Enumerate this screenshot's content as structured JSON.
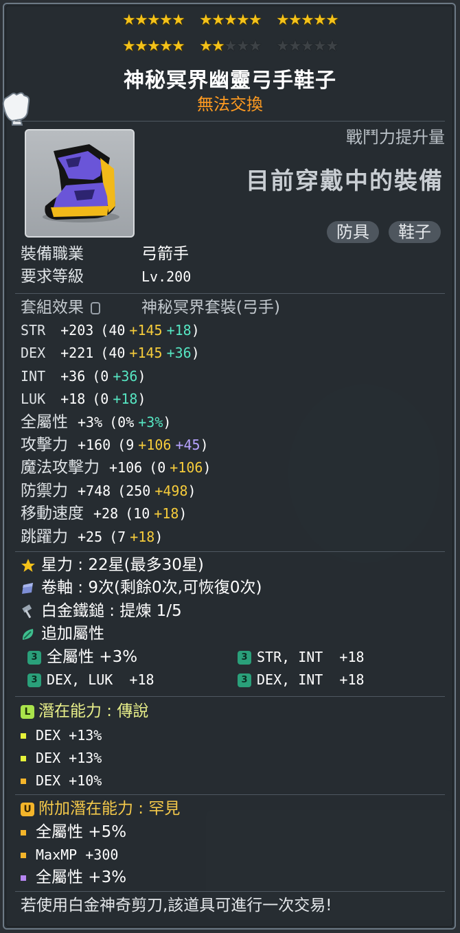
{
  "stars": {
    "filled": 22,
    "total": 30
  },
  "item": {
    "name": "神秘冥界幽靈弓手鞋子",
    "trade_status": "無法交換",
    "combat_power_label": "戰鬥力提升量",
    "equipped_label": "目前穿戴中的裝備",
    "tags": [
      "防具",
      "鞋子"
    ]
  },
  "requirements": {
    "job_label": "裝備職業",
    "job_value": "弓箭手",
    "level_label": "要求等級",
    "level_value": "Lv.200"
  },
  "set": {
    "label": "套組效果",
    "value": "神秘冥界套裝(弓手)"
  },
  "stats": [
    {
      "name": "STR",
      "total": "+203",
      "base": "(40",
      "bonus1": "+145",
      "bonus2": "+18",
      "close": ")",
      "c1": "yellow",
      "c2": "green"
    },
    {
      "name": "DEX",
      "total": "+221",
      "base": "(40",
      "bonus1": "+145",
      "bonus2": "+36",
      "close": ")",
      "c1": "yellow",
      "c2": "green"
    },
    {
      "name": "INT",
      "total": "+36",
      "base": "(0",
      "bonus1": "+36",
      "bonus2": "",
      "close": ")",
      "c1": "green",
      "c2": ""
    },
    {
      "name": "LUK",
      "total": "+18",
      "base": "(0",
      "bonus1": "+18",
      "bonus2": "",
      "close": ")",
      "c1": "green",
      "c2": ""
    },
    {
      "name": "全屬性",
      "total": "+3%",
      "base": "(0%",
      "bonus1": "+3%",
      "bonus2": "",
      "close": ")",
      "c1": "green",
      "c2": ""
    },
    {
      "name": "攻擊力",
      "total": "+160",
      "base": "(9",
      "bonus1": "+106",
      "bonus2": "+45",
      "close": ")",
      "c1": "yellow",
      "c2": "purple"
    },
    {
      "name": "魔法攻擊力",
      "total": "+106",
      "base": "(0",
      "bonus1": "+106",
      "bonus2": "",
      "close": ")",
      "c1": "yellow",
      "c2": ""
    },
    {
      "name": "防禦力",
      "total": "+748",
      "base": "(250",
      "bonus1": "+498",
      "bonus2": "",
      "close": ")",
      "c1": "yellow",
      "c2": ""
    },
    {
      "name": "移動速度",
      "total": "+28",
      "base": "(10",
      "bonus1": "+18",
      "bonus2": "",
      "close": ")",
      "c1": "yellow",
      "c2": ""
    },
    {
      "name": "跳躍力",
      "total": "+25",
      "base": "(7",
      "bonus1": "+18",
      "bonus2": "",
      "close": ")",
      "c1": "yellow",
      "c2": ""
    }
  ],
  "enhance": {
    "starforce": "星力 : 22星(最多30星)",
    "scroll": "卷軸 : 9次(剩餘0次,可恢復0次)",
    "hammer": "白金鐵鎚 : 提煉 1/5",
    "flame_title": "追加屬性",
    "flames": [
      "全屬性 +3%",
      "STR, INT  +18",
      "DEX, LUK  +18",
      "DEX, INT  +18"
    ],
    "flame_tier": "3"
  },
  "potential": {
    "badge": "L",
    "title": "潛在能力 : 傳說",
    "lines": [
      "DEX +13%",
      "DEX +13%",
      "DEX +10%"
    ],
    "bullet_colors": [
      "#e6f23a",
      "#e6f23a",
      "#f4b52a"
    ]
  },
  "additional": {
    "badge": "U",
    "title": "附加潛在能力 : 罕見",
    "lines": [
      "全屬性 +5%",
      "MaxMP +300",
      "全屬性 +3%"
    ],
    "bullet_colors": [
      "#f4b52a",
      "#f4b52a",
      "#b686f2"
    ]
  },
  "footer": "若使用白金神奇剪刀,該道具可進行一次交易!",
  "colors": {
    "yellow": "#f6cc3b",
    "green": "#56e6c2",
    "purple": "#b7a3ff",
    "orange": "#ff9b21",
    "legendary": "#a9e34b",
    "unique": "#f4b52a"
  }
}
